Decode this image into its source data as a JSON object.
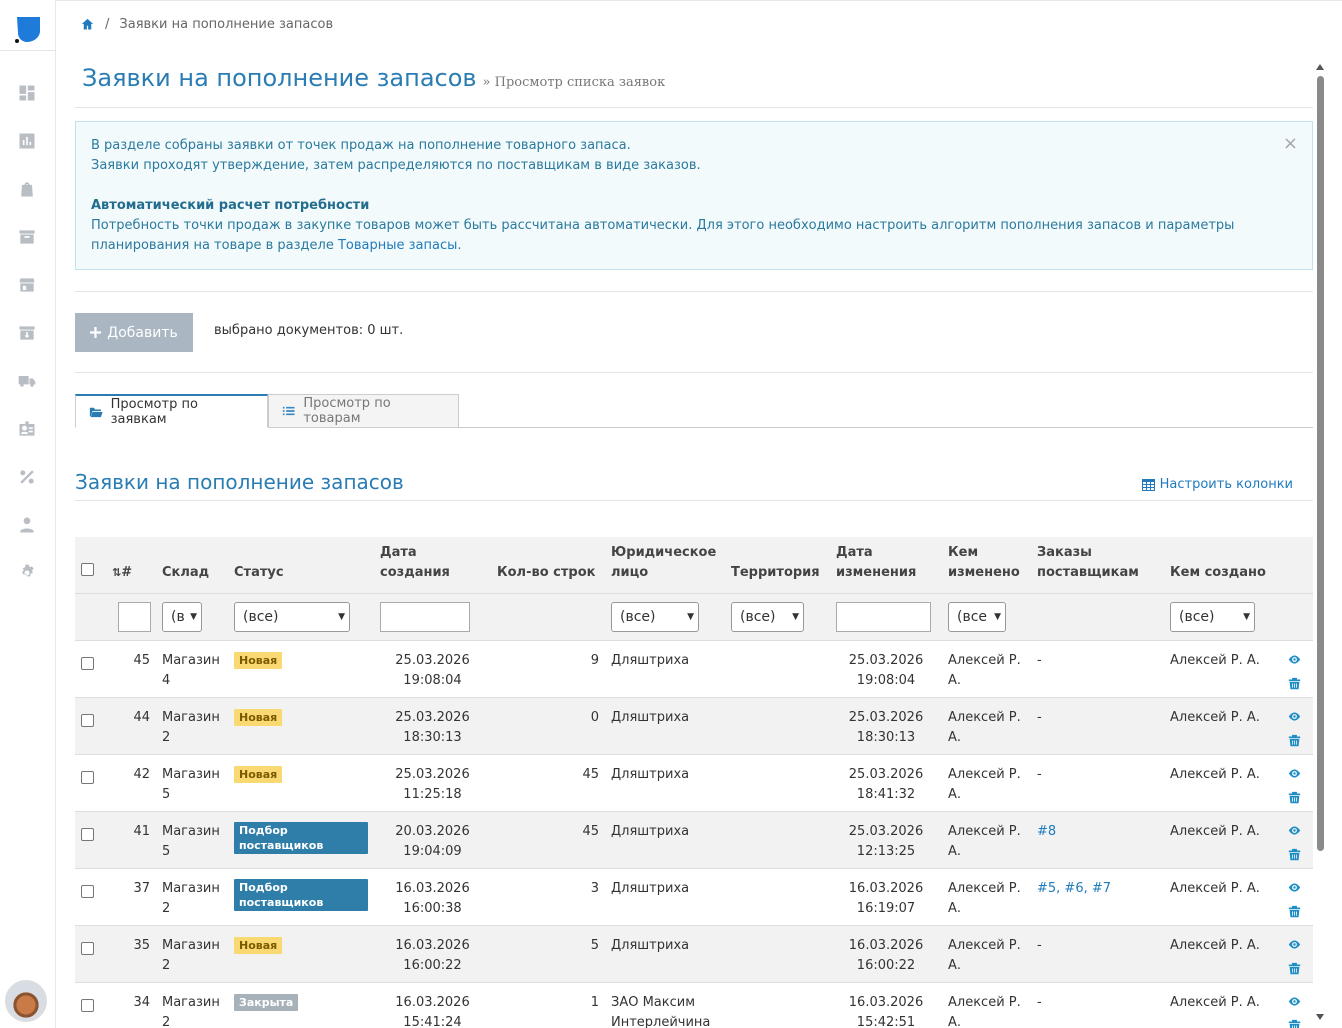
{
  "breadcrumb": {
    "current": "Заявки на пополнение запасов"
  },
  "page": {
    "title": "Заявки на пополнение запасов",
    "subtitle": "» Просмотр списка заявок"
  },
  "alert": {
    "line1": "В разделе собраны заявки от точек продаж на пополнение товарного запаса.",
    "line2": "Заявки проходят утверждение, затем распределяются по поставщикам в виде заказов.",
    "heading": "Автоматический расчет потребности",
    "line3_prefix": "Потребность точки продаж в закупке товаров может быть рассчитана автоматически. Для этого необходимо настроить алгоритм пополнения запасов и параметры планирования на товаре в разделе ",
    "line3_link": "Товарные запасы",
    "line3_suffix": ".",
    "close": "×"
  },
  "toolbar": {
    "add_label": "Добавить",
    "selected_text": "выбрано документов: 0 шт."
  },
  "tabs": [
    {
      "label": "Просмотр по заявкам"
    },
    {
      "label": "Просмотр по товарам"
    }
  ],
  "section": {
    "title": "Заявки на пополнение запасов",
    "configure_label": "Настроить колонки"
  },
  "columns": {
    "id": "#",
    "warehouse": "Склад",
    "status": "Статус",
    "created_l1": "Дата",
    "created_l2": "создания",
    "lines": "Кол-во строк",
    "legal_l1": "Юридическое",
    "legal_l2": "лицо",
    "territory": "Территория",
    "changed_l1": "Дата",
    "changed_l2": "изменения",
    "changed_by_l1": "Кем",
    "changed_by_l2": "изменено",
    "orders_l1": "Заказы",
    "orders_l2": "поставщикам",
    "created_by": "Кем создано"
  },
  "filters": {
    "warehouse": "(все)",
    "status": "(все)",
    "legal": "(все)",
    "territory": "(все)",
    "changed_by": "(все)",
    "created_by": "(все)"
  },
  "rows": [
    {
      "id": "45",
      "wh1": "Магазин",
      "wh2": "4",
      "status": "Новая",
      "c_date": "25.03.2026",
      "c_time": "19:08:04",
      "lines": "9",
      "legal1": "Дляштриха",
      "legal2": "",
      "territory": "",
      "m_date": "25.03.2026",
      "m_time": "19:08:04",
      "by1": "Алексей Р.",
      "by2": "А.",
      "orders": "-",
      "creator": "Алексей Р. А."
    },
    {
      "id": "44",
      "wh1": "Магазин",
      "wh2": "2",
      "status": "Новая",
      "c_date": "25.03.2026",
      "c_time": "18:30:13",
      "lines": "0",
      "legal1": "Дляштриха",
      "legal2": "",
      "territory": "",
      "m_date": "25.03.2026",
      "m_time": "18:30:13",
      "by1": "Алексей Р.",
      "by2": "А.",
      "orders": "-",
      "creator": "Алексей Р. А."
    },
    {
      "id": "42",
      "wh1": "Магазин",
      "wh2": "5",
      "status": "Новая",
      "c_date": "25.03.2026",
      "c_time": "11:25:18",
      "lines": "45",
      "legal1": "Дляштриха",
      "legal2": "",
      "territory": "",
      "m_date": "25.03.2026",
      "m_time": "18:41:32",
      "by1": "Алексей Р.",
      "by2": "А.",
      "orders": "-",
      "creator": "Алексей Р. А."
    },
    {
      "id": "41",
      "wh1": "Магазин",
      "wh2": "5",
      "status": "Подбор поставщиков",
      "c_date": "20.03.2026",
      "c_time": "19:04:09",
      "lines": "45",
      "legal1": "Дляштриха",
      "legal2": "",
      "territory": "",
      "m_date": "25.03.2026",
      "m_time": "12:13:25",
      "by1": "Алексей Р.",
      "by2": "А.",
      "orders": "#8",
      "creator": "Алексей Р. А."
    },
    {
      "id": "37",
      "wh1": "Магазин",
      "wh2": "2",
      "status": "Подбор поставщиков",
      "c_date": "16.03.2026",
      "c_time": "16:00:38",
      "lines": "3",
      "legal1": "Дляштриха",
      "legal2": "",
      "territory": "",
      "m_date": "16.03.2026",
      "m_time": "16:19:07",
      "by1": "Алексей Р.",
      "by2": "А.",
      "orders": "#5, #6, #7",
      "creator": "Алексей Р. А."
    },
    {
      "id": "35",
      "wh1": "Магазин",
      "wh2": "2",
      "status": "Новая",
      "c_date": "16.03.2026",
      "c_time": "16:00:22",
      "lines": "5",
      "legal1": "Дляштриха",
      "legal2": "",
      "territory": "",
      "m_date": "16.03.2026",
      "m_time": "16:00:22",
      "by1": "Алексей Р.",
      "by2": "А.",
      "orders": "-",
      "creator": "Алексей Р. А."
    },
    {
      "id": "34",
      "wh1": "Магазин",
      "wh2": "2",
      "status": "Закрыта",
      "c_date": "16.03.2026",
      "c_time": "15:41:24",
      "lines": "1",
      "legal1": "ЗАО Максим",
      "legal2": "Интерлейчина",
      "territory": "",
      "m_date": "16.03.2026",
      "m_time": "15:42:51",
      "by1": "Алексей Р.",
      "by2": "А.",
      "orders": "-",
      "creator": "Алексей Р. А."
    }
  ],
  "colors": {
    "accent": "#2a7db4",
    "badge_new": "#fbd972",
    "badge_pick": "#2e7ea9",
    "badge_closed": "#a7b1b9"
  }
}
